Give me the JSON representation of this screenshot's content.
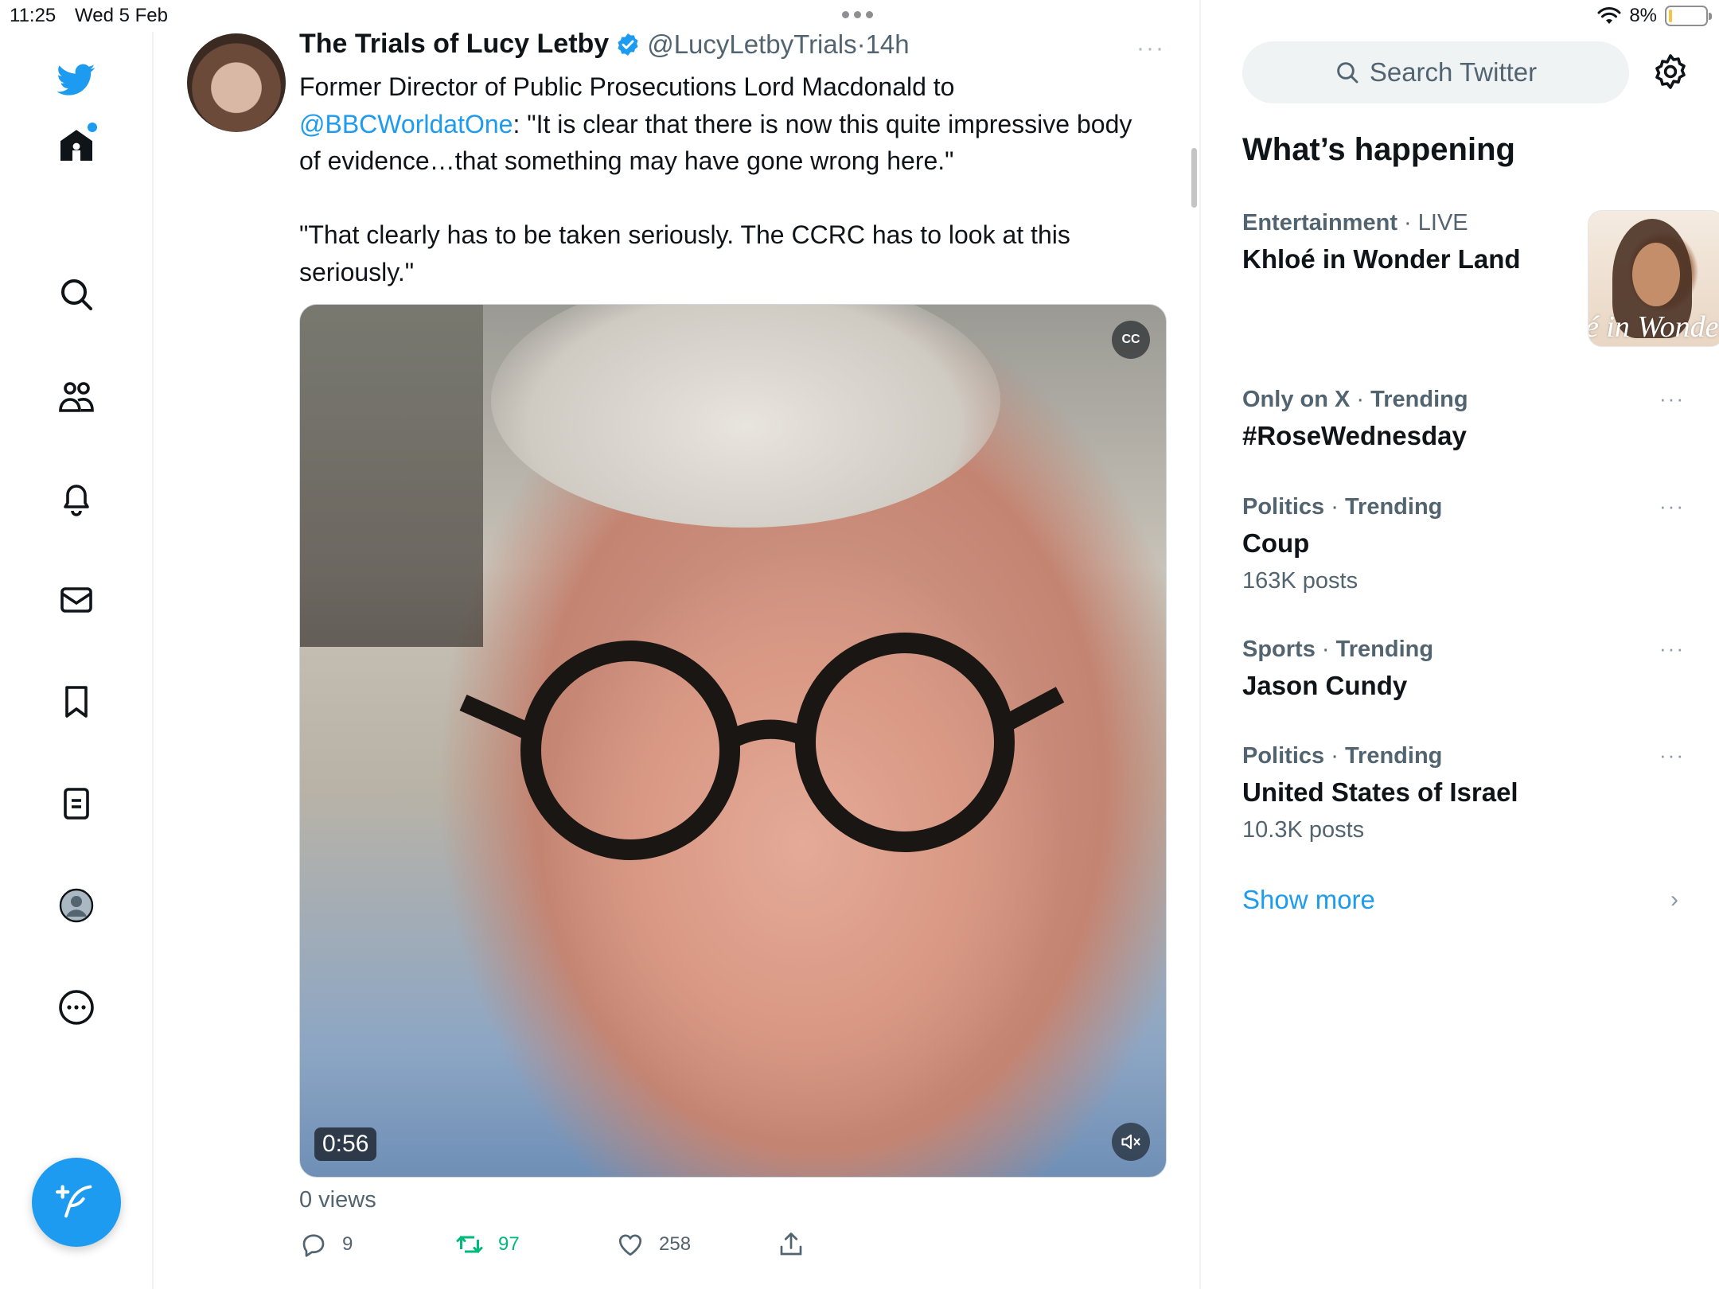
{
  "status_bar": {
    "time": "11:25",
    "date": "Wed 5 Feb",
    "battery": "8%",
    "battery_level": 0.08
  },
  "nav": {
    "items": [
      "home",
      "explore",
      "communities",
      "notifications",
      "messages",
      "bookmarks",
      "lists",
      "profile",
      "more"
    ],
    "has_home_notification": true
  },
  "tweet": {
    "author_name": "The Trials of Lucy Letby",
    "handle": "@LucyLetbyTrials",
    "separator": "·",
    "time": "14h",
    "more": "···",
    "text_part1": "Former Director of Public Prosecutions Lord Macdonald to\n",
    "mention": "@BBCWorldatOne",
    "text_part2": ": \"It is clear that there is now this quite impressive body of evidence…that something may have gone wrong here.\"\n\n\"That clearly has to be taken seriously. The CCRC has to look at this seriously.\"",
    "video": {
      "duration": "0:56",
      "cc_label": "CC"
    },
    "views": "0 views",
    "replies": "9",
    "retweets": "97",
    "likes": "258"
  },
  "sidebar": {
    "search_placeholder": "Search Twitter",
    "section_title": "What’s happening",
    "trends": [
      {
        "category": "Entertainment",
        "status": "LIVE",
        "title": "Khloé in Wonder Land",
        "image_text": "é in Wonder L"
      },
      {
        "category": "Only on X",
        "status": "Trending",
        "title": "#RoseWednesday",
        "posts": ""
      },
      {
        "category": "Politics",
        "status": "Trending",
        "title": "Coup",
        "posts": "163K posts"
      },
      {
        "category": "Sports",
        "status": "Trending",
        "title": "Jason Cundy",
        "posts": ""
      },
      {
        "category": "Politics",
        "status": "Trending",
        "title": "United States of Israel",
        "posts": "10.3K posts"
      }
    ],
    "show_more": "Show more",
    "trend_more": "···",
    "chevron": "›"
  },
  "colors": {
    "accent": "#1d9bf0",
    "retweet": "#00ba7c",
    "secondary_text": "#536471"
  }
}
